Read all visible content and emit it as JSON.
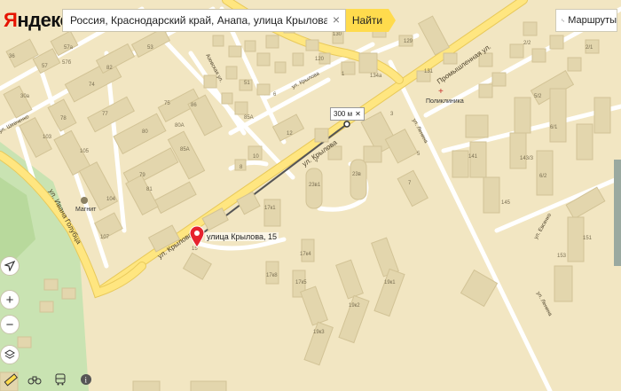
{
  "header": {
    "logo_prefix": "Я",
    "logo_rest": "ндекс",
    "search_value": "Россия, Краснодарский край, Анапа, улица Крылова, 15",
    "find_label": "Найти",
    "routes_label": "Маршруты"
  },
  "map": {
    "streets": {
      "krylova_main_1": "ул. Крылова",
      "krylova_main_2": "ул. Крылова",
      "krylova_upper": "ул. Крылова",
      "azovskaya": "Азовская ул.",
      "promyshlennaya": "Промышленная ул.",
      "ivana_golubtsa": "ул. Ивана Голубца",
      "lenina_1": "ул. Ленина",
      "lenina_2": "ул. Ленина",
      "evsenko": "ул. Евсенко",
      "left_street": "ул. Шевченко"
    },
    "pois": {
      "magnit": "Магнит",
      "poliklinika": "Поликлиника"
    },
    "marker_label": "улица Крылова, 15",
    "distance_label": "300 м",
    "house_numbers": [
      "57б",
      "57а",
      "57",
      "30а",
      "82",
      "53",
      "36",
      "74",
      "76",
      "77",
      "78",
      "80",
      "75",
      "86",
      "101",
      "103",
      "105",
      "73",
      "71",
      "104",
      "106",
      "99",
      "120",
      "130",
      "134",
      "140",
      "132",
      "136",
      "134а",
      "6",
      "2",
      "1",
      "41",
      "46",
      "50",
      "54",
      "56",
      "8",
      "10",
      "12",
      "4",
      "45",
      "17д",
      "17е",
      "17в",
      "17г",
      "17б",
      "17а",
      "19в",
      "19г",
      "19д",
      "23в",
      "23в1",
      "3",
      "5",
      "7",
      "129",
      "131",
      "6/1",
      "5/2",
      "5/1",
      "6/2",
      "2/2",
      "2/1",
      "151",
      "153",
      "141",
      "143/3",
      "145",
      "1/2",
      "4/2",
      "107",
      "1",
      "3а",
      "1/1",
      "100",
      "15",
      "19к",
      "80А",
      "85А",
      "108",
      "102"
    ],
    "colors": {
      "background": "#f2e6c2",
      "building": "#e3d6ad",
      "road": "#ffffff",
      "major_road": "#ffe680",
      "park": "#c9e3b2",
      "marker": "#e6232e",
      "accent": "#ffdb4d"
    }
  },
  "controls": {
    "icons": [
      "navigate-icon",
      "zoom-in-icon",
      "zoom-out-icon",
      "layers-icon"
    ],
    "bottom_icons": [
      "ruler-icon",
      "binoculars-icon",
      "bus-icon",
      "info-icon"
    ]
  }
}
